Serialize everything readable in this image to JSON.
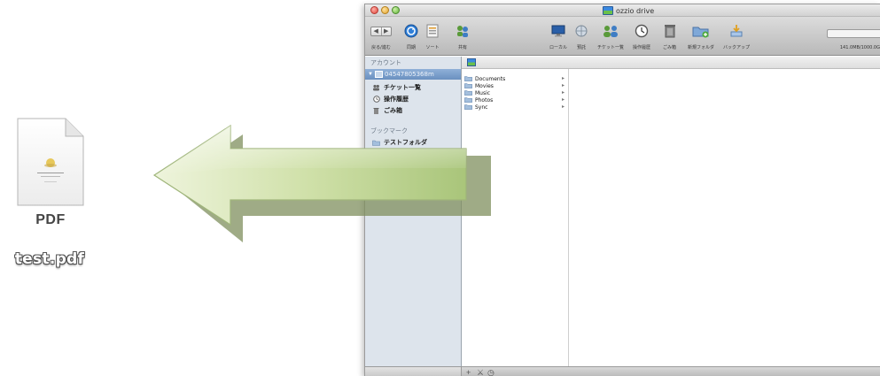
{
  "desktop": {
    "file": {
      "type_label": "PDF",
      "name": "test.pdf",
      "icon": "pdf-document-icon"
    },
    "arrow": {
      "icon": "left-arrow-icon",
      "color": "#b9cf8c"
    }
  },
  "window": {
    "title": "ozzio drive",
    "toolbar": {
      "items": [
        {
          "id": "back-forward",
          "label": "戻る/進む",
          "icon": "nav-arrows-icon"
        },
        {
          "id": "sync",
          "label": "同期",
          "icon": "sync-icon"
        },
        {
          "id": "sort",
          "label": "ソート",
          "icon": "sort-icon"
        },
        {
          "id": "share",
          "label": "共有",
          "icon": "share-icon"
        },
        {
          "id": "local",
          "label": "ローカル",
          "icon": "monitor-icon"
        },
        {
          "id": "preview",
          "label": "預託",
          "icon": "globe-icon"
        },
        {
          "id": "tickets",
          "label": "チケット一覧",
          "icon": "people-icon"
        },
        {
          "id": "history",
          "label": "操作履歴",
          "icon": "clock-icon"
        },
        {
          "id": "trash",
          "label": "ごみ箱",
          "icon": "trash-icon"
        },
        {
          "id": "new-folder",
          "label": "新規フォルダ",
          "icon": "new-folder-icon"
        },
        {
          "id": "backup",
          "label": "バックアップ",
          "icon": "backup-icon"
        }
      ],
      "storage": "141.0MB/1000.0G"
    },
    "sidebar": {
      "account_header": "アカウント",
      "account_id": "04547805368m",
      "items": [
        {
          "label": "チケット一覧",
          "icon": "people-icon"
        },
        {
          "label": "操作履歴",
          "icon": "clock-icon"
        },
        {
          "label": "ごみ箱",
          "icon": "trash-icon"
        }
      ],
      "bookmark_header": "ブックマーク",
      "bookmarks": [
        {
          "label": "テストフォルダ",
          "icon": "folder-icon"
        }
      ]
    },
    "folders": [
      {
        "name": "Documents"
      },
      {
        "name": "Movies"
      },
      {
        "name": "Music"
      },
      {
        "name": "Photos"
      },
      {
        "name": "Sync"
      }
    ],
    "bottom_bar": {
      "icons": [
        "add-icon",
        "share-icon",
        "clock-icon"
      ]
    }
  }
}
